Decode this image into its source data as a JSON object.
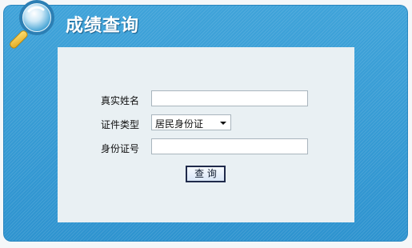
{
  "header": {
    "title": "成绩查询",
    "icon": "magnifier-icon"
  },
  "form": {
    "name_label": "真实姓名",
    "name_value": "",
    "id_type_label": "证件类型",
    "id_type_selected": "居民身份证",
    "id_number_label": "身份证号",
    "id_number_value": "",
    "query_button": "查 询"
  },
  "colors": {
    "panel_blue": "#3fa3d9",
    "content_bg": "#e9f0f3",
    "button_border": "#1f2a4a"
  }
}
